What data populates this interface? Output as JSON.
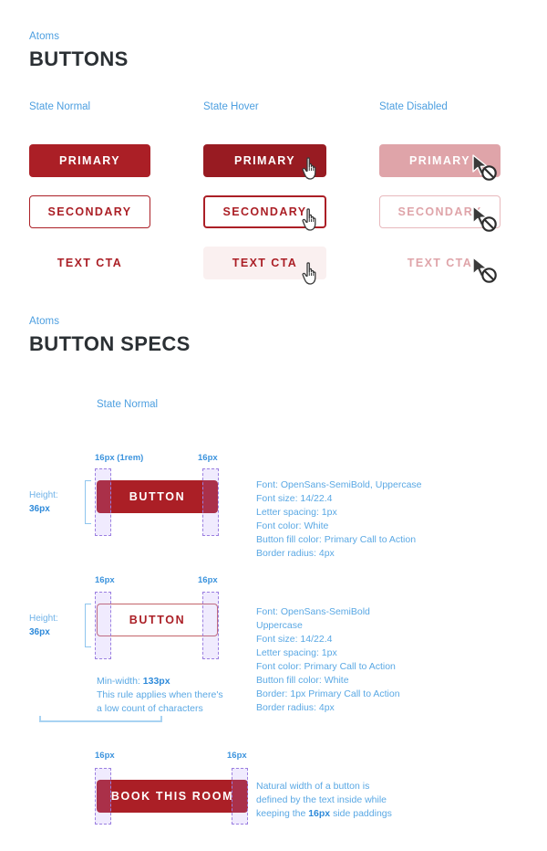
{
  "colors": {
    "primary_cta": "#ab1f26",
    "primary_hover": "#981b22",
    "disabled_pink": "#dfa4a9",
    "accent_blue": "#4d9fe0",
    "heading": "#2b3034",
    "text_cta_hover_bg": "#faf0f0",
    "padding_overlay": "#a78bfa"
  },
  "sections": [
    {
      "eyebrow": "Atoms",
      "title": "BUTTONS",
      "columns": [
        {
          "label": "State Normal",
          "buttons": [
            {
              "label": "PRIMARY",
              "variant": "primary"
            },
            {
              "label": "SECONDARY",
              "variant": "secondary"
            },
            {
              "label": "TEXT CTA",
              "variant": "text"
            }
          ]
        },
        {
          "label": "State Hover",
          "buttons": [
            {
              "label": "PRIMARY",
              "variant": "primary-hover"
            },
            {
              "label": "SECONDARY",
              "variant": "secondary-hover"
            },
            {
              "label": "TEXT CTA",
              "variant": "text-hover"
            }
          ]
        },
        {
          "label": "State Disabled",
          "buttons": [
            {
              "label": "PRIMARY",
              "variant": "primary-disabled"
            },
            {
              "label": "SECONDARY",
              "variant": "secondary-disabled"
            },
            {
              "label": "TEXT CTA",
              "variant": "text-disabled"
            }
          ]
        }
      ]
    },
    {
      "eyebrow": "Atoms",
      "title": "BUTTON SPECS",
      "state_label": "State Normal"
    }
  ],
  "specs": [
    {
      "button_label": "BUTTON",
      "variant": "primary",
      "height_label": "Height:",
      "height_value": "36px",
      "pad_left_label": "16px (1rem)",
      "pad_right_label": "16px",
      "lines": [
        "Font: OpenSans-SemiBold, Uppercase",
        "Font size: 14/22.4",
        "Letter spacing: 1px",
        "Font color: White",
        "Button fill color: Primary Call to Action",
        "Border radius: 4px"
      ]
    },
    {
      "button_label": "BUTTON",
      "variant": "secondary",
      "height_label": "Height:",
      "height_value": "36px",
      "pad_left_label": "16px",
      "pad_right_label": "16px",
      "lines": [
        "Font: OpenSans-SemiBold",
        "Uppercase",
        "Font size: 14/22.4",
        "Letter spacing: 1px",
        "Font color: Primary Call to Action",
        "Button fill color: White",
        "Border: 1px Primary Call to Action",
        "Border radius: 4px"
      ],
      "min_width_note": {
        "prefix": "Min-width: ",
        "value": "133px",
        "line2": "This rule applies when there's",
        "line3": "a low count of characters"
      }
    },
    {
      "button_label": "BOOK THIS ROOM",
      "variant": "primary",
      "pad_left_label": "16px",
      "pad_right_label": "16px",
      "natural_note": {
        "line1": "Natural width of a button is",
        "line2": "defined by the text inside while",
        "line3_prefix": "keeping the ",
        "line3_value": "16px",
        "line3_suffix": " side paddings"
      }
    }
  ]
}
